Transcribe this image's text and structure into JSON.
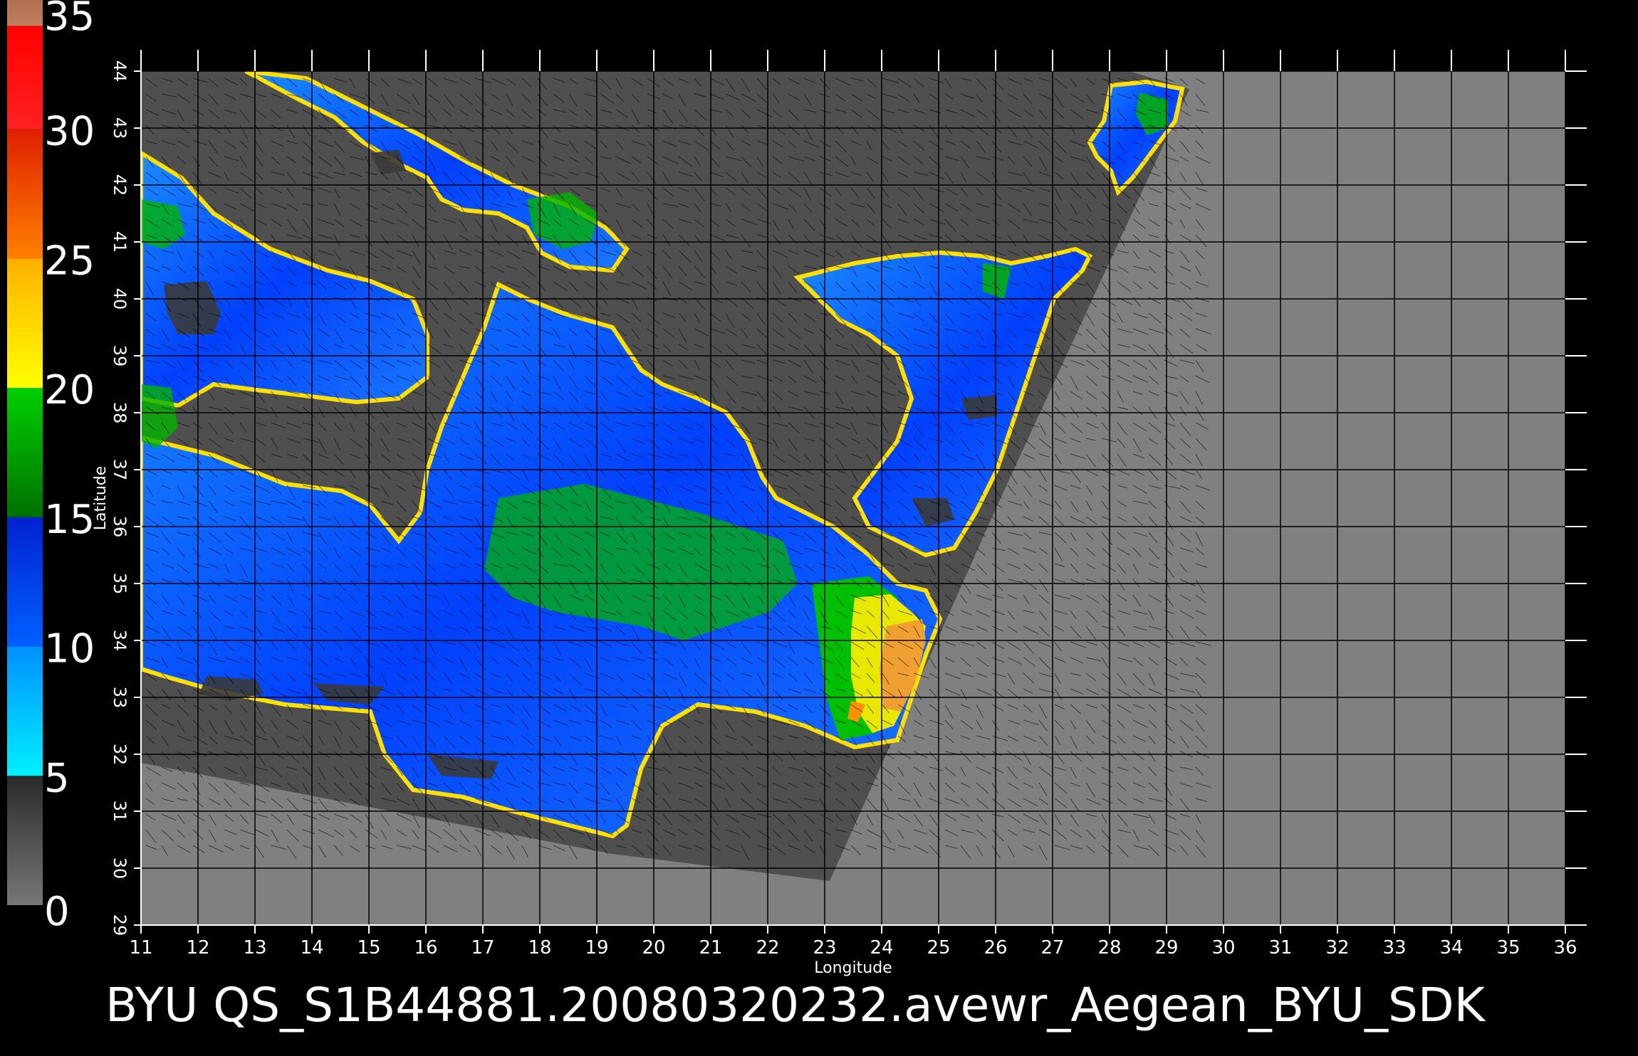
{
  "map": {
    "caption": "BYU  QS_S1B44881.20080320232.avewr_Aegean_BYU_SDK",
    "x_axis": {
      "label": "Longitude",
      "ticks": [
        "11",
        "12",
        "13",
        "14",
        "15",
        "16",
        "17",
        "18",
        "19",
        "20",
        "21",
        "22",
        "23",
        "24",
        "25",
        "26",
        "27",
        "28",
        "29",
        "30",
        "31",
        "32",
        "33",
        "34",
        "35",
        "36"
      ]
    },
    "y_axis": {
      "label": "Latitude",
      "ticks": [
        "29",
        "30",
        "31",
        "32",
        "33",
        "34",
        "35",
        "36",
        "37",
        "38",
        "39",
        "40",
        "41",
        "42",
        "43",
        "44"
      ]
    },
    "extent": {
      "lon_min": 11,
      "lon_max": 36,
      "lat_min": 29,
      "lat_max": 44
    },
    "grid": true,
    "colorbar": {
      "labels": [
        "0",
        "5",
        "10",
        "15",
        "20",
        "25",
        "30",
        "35"
      ],
      "segments": [
        {
          "from": 0,
          "to": 5,
          "color_low": "#777777",
          "color_high": "#2a2a2a"
        },
        {
          "from": 5,
          "to": 10,
          "color_low": "#00f0ff",
          "color_high": "#0090ff"
        },
        {
          "from": 10,
          "to": 15,
          "color_low": "#0060ff",
          "color_high": "#0022d0"
        },
        {
          "from": 15,
          "to": 20,
          "color_low": "#007000",
          "color_high": "#00d000"
        },
        {
          "from": 20,
          "to": 25,
          "color_low": "#ffff00",
          "color_high": "#ffb000"
        },
        {
          "from": 25,
          "to": 30,
          "color_low": "#ff8000",
          "color_high": "#e02000"
        },
        {
          "from": 30,
          "to": 34,
          "color_low": "#ff2020",
          "color_high": "#ff0000"
        },
        {
          "from": 34,
          "to": 35,
          "color_low": "#c08060",
          "color_high": "#b07050"
        }
      ]
    },
    "colors": {
      "background": "#000000",
      "no_data": "#808080",
      "land": "#4f4f4f",
      "grid": "#000000",
      "caption": "#ffffff",
      "ticks": "#ffffff"
    }
  }
}
